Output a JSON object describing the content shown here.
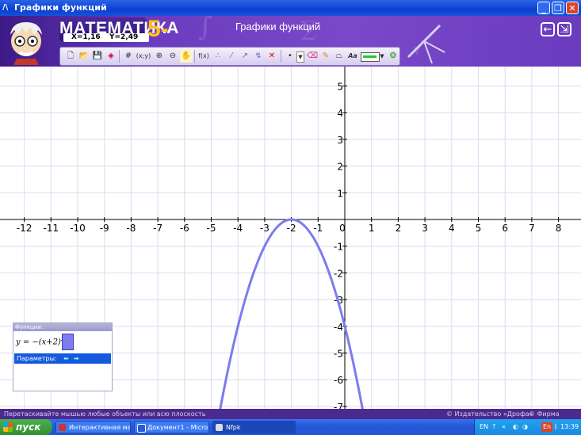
{
  "window": {
    "title": "Графики функций"
  },
  "header": {
    "logo_text": "МАТЕМАТИКА",
    "grade_text": "5-11",
    "x_readout": "X=1,16",
    "y_readout": "Y=2,49",
    "app_title": "Графики функций"
  },
  "toolbar": {
    "items": [
      "new-file-icon",
      "open-folder-icon",
      "save-icon",
      "erase-icon",
      "grid-icon",
      "coords-toggle",
      "zoom-in-icon",
      "zoom-out-icon",
      "hand-pan-icon",
      "fx-function-icon",
      "point-tool-icon",
      "segment-tool-icon",
      "line-tool-icon",
      "tangent-tool-icon",
      "delete-icon",
      "point-style-icon",
      "dropdown-icon",
      "eraser-icon",
      "pencil-icon",
      "fill-icon",
      "text-tool-icon",
      "line-color-picker",
      "settings-icon"
    ],
    "coords_label": "(x;y)",
    "fx_label": "f(x)",
    "text_tool_label": "Aa",
    "color": "#22cc22"
  },
  "chart_data": {
    "type": "line",
    "title": "",
    "xlabel": "",
    "ylabel": "",
    "xlim": [
      -12.3,
      8.7
    ],
    "ylim": [
      -7.2,
      5.5
    ],
    "x_ticks": [
      -12,
      -11,
      -10,
      -9,
      -8,
      -7,
      -6,
      -5,
      -4,
      -3,
      -2,
      -1,
      0,
      1,
      2,
      3,
      4,
      5,
      6,
      7,
      8
    ],
    "y_ticks": [
      5,
      4,
      3,
      2,
      1,
      -1,
      -2,
      -3,
      -4,
      -5,
      -6,
      -7
    ],
    "grid": true,
    "series": [
      {
        "function": "y = -(x+2)^2",
        "vertex": [
          -2,
          0
        ],
        "x_range": [
          -4.7,
          0.7
        ],
        "color": "#7b7cef"
      }
    ]
  },
  "function_panel": {
    "header": "Функции:",
    "formula": "y = −(x+2)",
    "exponent": "2",
    "params_label": "Параметры:",
    "color": "#7d7cf0"
  },
  "status": {
    "hint": "Перетаскивайте мышью любые объекты или всю плоскость",
    "publisher": "© Издательство «Дрофа»",
    "firm": "© Фирма «ДОС»"
  },
  "taskbar": {
    "start_label": "пуск",
    "tasks": [
      "Интерактивная мат...",
      "Документ1 - Microso...",
      "Nfpk"
    ],
    "lang": "EN",
    "time": "13:39"
  }
}
